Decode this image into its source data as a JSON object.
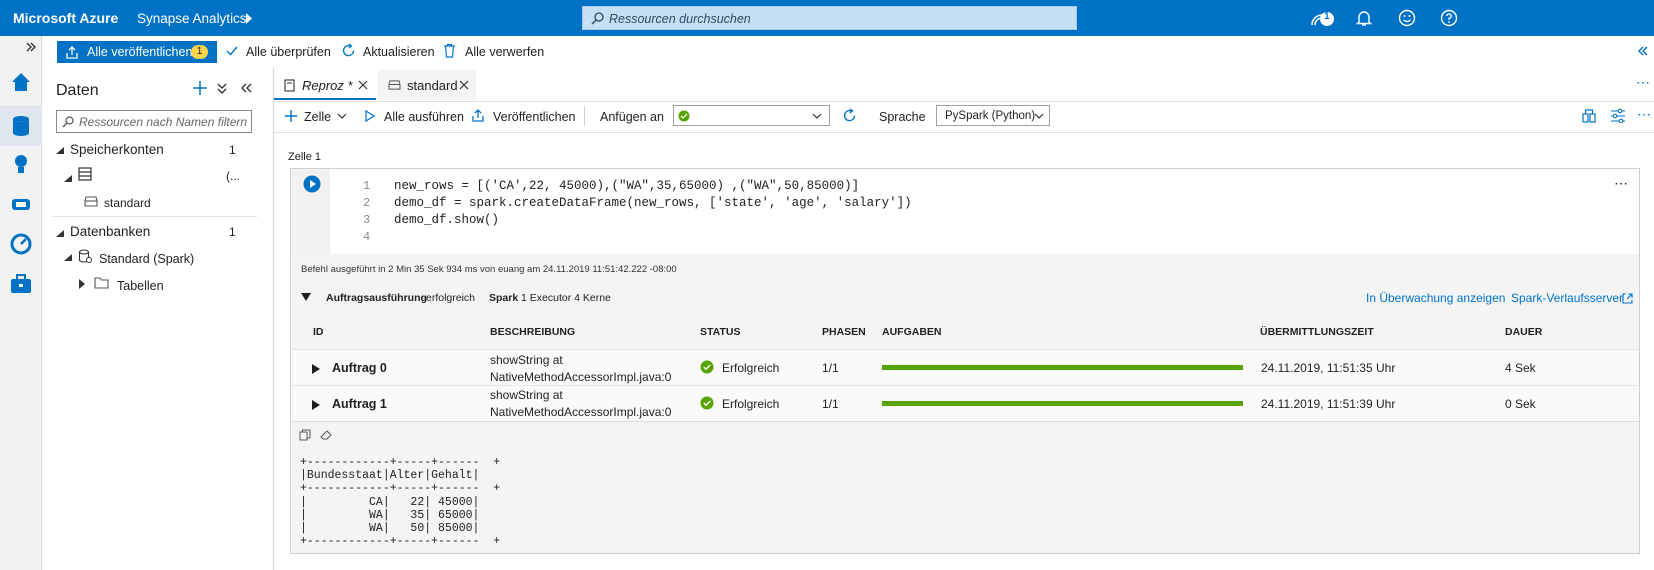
{
  "topbar": {
    "brand": "Microsoft Azure",
    "service": "Synapse Analytics",
    "search_placeholder": "Ressourcen durchsuchen",
    "notification_count": "1"
  },
  "commandbar": {
    "publish_all": "Alle veröffentlichen",
    "publish_badge": "1",
    "validate_all": "Alle überprüfen",
    "refresh": "Aktualisieren",
    "discard_all": "Alle verwerfen"
  },
  "data_panel": {
    "title": "Daten",
    "filter_placeholder": "Ressourcen nach Namen filtern",
    "storage_section": "Speicherkonten",
    "storage_count": "1",
    "storage_item_suffix": "(...",
    "storage_child": "standard",
    "db_section": "Datenbanken",
    "db_count": "1",
    "db_item": "Standard (Spark)",
    "db_child": "Tabellen"
  },
  "tabs": [
    {
      "label": "Reproz *"
    },
    {
      "label": "standard"
    }
  ],
  "notebook_toolbar": {
    "cell": "Zelle",
    "run_all": "Alle ausführen",
    "publish": "Veröffentlichen",
    "attach_to": "Anfügen an",
    "language_label": "Sprache",
    "language_value": "PySpark (Python)"
  },
  "cell": {
    "title": "Zelle 1",
    "line_numbers": [
      "1",
      "2",
      "3",
      "4"
    ],
    "code_lines": [
      "new_rows = [('CA',22, 45000),(\"WA\",35,65000) ,(\"WA\",50,85000)]",
      "demo_df = spark.createDataFrame(new_rows, ['state', 'age', 'salary'])",
      "demo_df.show()",
      ""
    ]
  },
  "output": {
    "exec_info": "Befehl ausgeführt in 2 Min 35 Sek 934 ms von euang am 24.11.2019 11:51:42.222 -08:00",
    "job_exec_label": "Auftragsausführung",
    "job_exec_status": "erfolgreich",
    "spark_label": "Spark",
    "spark_info": "1 Executor 4 Kerne",
    "monitor_link": "In Überwachung anzeigen",
    "history_link": "Spark-Verlaufsserver",
    "headers": {
      "id": "ID",
      "description": "BESCHREIBUNG",
      "status": "STATUS",
      "phases": "PHASEN",
      "tasks": "AUFGABEN",
      "submitted": "ÜBERMITTLUNGSZEIT",
      "duration": "DAUER"
    },
    "jobs": [
      {
        "id": "Auftrag 0",
        "desc1": "showString at",
        "desc2": "NativeMethodAccessorImpl.java:0",
        "status": "Erfolgreich",
        "phases": "1/1",
        "progress": 1.0,
        "submitted": "24.11.2019, 11:51:35 Uhr",
        "duration": "4 Sek"
      },
      {
        "id": "Auftrag 1",
        "desc1": "showString at",
        "desc2": "NativeMethodAccessorImpl.java:0",
        "status": "Erfolgreich",
        "phases": "1/1",
        "progress": 1.0,
        "submitted": "24.11.2019, 11:51:39 Uhr",
        "duration": "0 Sek"
      }
    ],
    "result_table": "+------------+-----+------  +\n|Bundesstaat|Alter|Gehalt|\n+------------+-----+------  +\n|         CA|   22| 45000|\n|         WA|   35| 65000|\n|         WA|   50| 85000|\n+------------+-----+------  +"
  },
  "colors": {
    "azure_blue": "#0072c6",
    "success_green": "#57a300"
  }
}
